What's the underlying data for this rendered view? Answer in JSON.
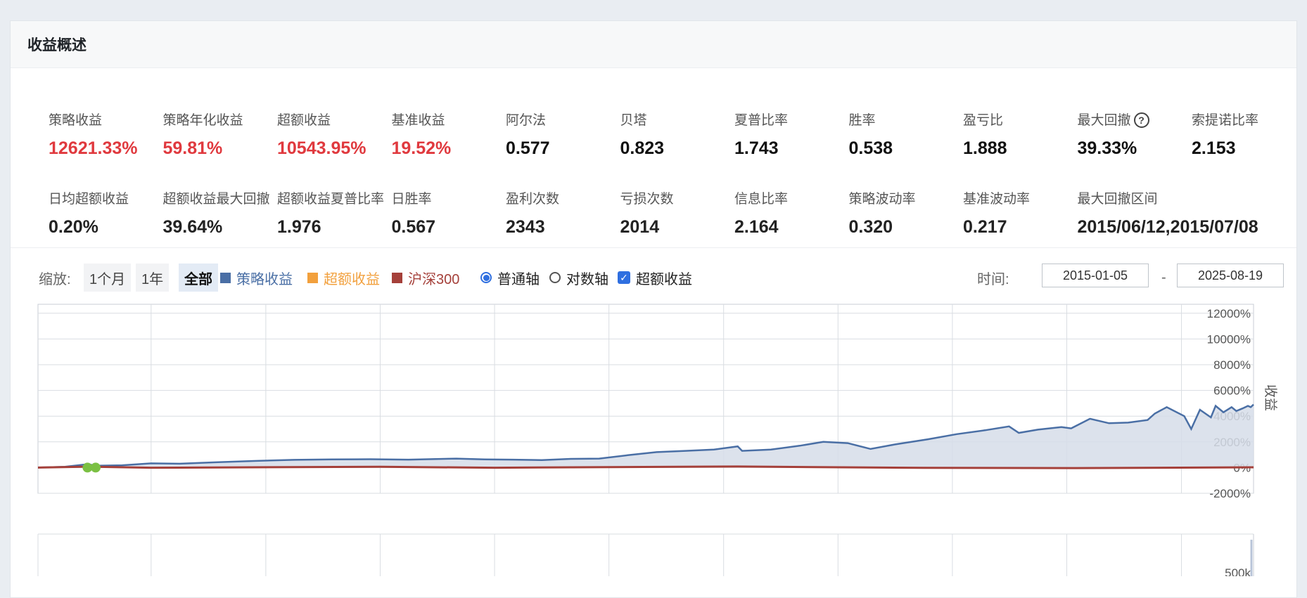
{
  "panel": {
    "title": "收益概述"
  },
  "metrics_row1": [
    {
      "label": "策略收益",
      "value": "12621.33%",
      "color": "#e0393e"
    },
    {
      "label": "策略年化收益",
      "value": "59.81%",
      "color": "#e0393e"
    },
    {
      "label": "超额收益",
      "value": "10543.95%",
      "color": "#e0393e"
    },
    {
      "label": "基准收益",
      "value": "19.52%",
      "color": "#e0393e"
    },
    {
      "label": "阿尔法",
      "value": "0.577",
      "color": "#111111"
    },
    {
      "label": "贝塔",
      "value": "0.823",
      "color": "#111111"
    },
    {
      "label": "夏普比率",
      "value": "1.743",
      "color": "#111111"
    },
    {
      "label": "胜率",
      "value": "0.538",
      "color": "#111111"
    },
    {
      "label": "盈亏比",
      "value": "1.888",
      "color": "#111111"
    },
    {
      "label": "最大回撤",
      "value": "39.33%",
      "color": "#111111",
      "help": "?"
    },
    {
      "label": "索提诺比率",
      "value": "2.153",
      "color": "#111111"
    }
  ],
  "metrics_row2": [
    {
      "label": "日均超额收益",
      "value": "0.20%"
    },
    {
      "label": "超额收益最大回撤",
      "value": "39.64%"
    },
    {
      "label": "超额收益夏普比率",
      "value": "1.976"
    },
    {
      "label": "日胜率",
      "value": "0.567"
    },
    {
      "label": "盈利次数",
      "value": "2343"
    },
    {
      "label": "亏损次数",
      "value": "2014"
    },
    {
      "label": "信息比率",
      "value": "2.164"
    },
    {
      "label": "策略波动率",
      "value": "0.320"
    },
    {
      "label": "基准波动率",
      "value": "0.217"
    },
    {
      "label": "最大回撤区间",
      "value": "2015/06/12,2015/07/08"
    }
  ],
  "toolbar": {
    "zoom_label": "缩放:",
    "zoom_1m": "1个月",
    "zoom_1y": "1年",
    "zoom_all": "全部",
    "legend_strategy": "策略收益",
    "legend_excess": "超额收益",
    "legend_benchmark": "沪深300",
    "axis_normal": "普通轴",
    "axis_log": "对数轴",
    "excess_toggle": "超额收益",
    "time_label": "时间:",
    "date_from": "2015-01-05",
    "date_sep": "-",
    "date_to": "2025-08-19"
  },
  "colors": {
    "strategy": "#4a6fa5",
    "excess": "#f2a03d",
    "benchmark": "#a5403a",
    "positive": "#e0393e",
    "drawdown_marker": "#7bc043"
  },
  "chart_data": {
    "type": "area",
    "ylabel": "收益",
    "yticks": [
      "12000%",
      "10000%",
      "8000%",
      "6000%",
      "4000%",
      "2000%",
      "0%",
      "-2000%"
    ],
    "ylim": [
      -2000,
      12700
    ],
    "xlim": [
      "2015-01-05",
      "2025-08-19"
    ],
    "xgrid_dates": [
      "2016-01-01",
      "2017-01-01",
      "2018-01-01",
      "2019-01-01",
      "2020-01-01",
      "2021-01-01",
      "2022-01-01",
      "2023-01-01",
      "2024-01-01",
      "2025-01-01"
    ],
    "drawdown_markers": [
      "2015-06-12",
      "2015-07-08"
    ],
    "series": [
      {
        "name": "策略收益",
        "values": [
          [
            "2015-01-05",
            0
          ],
          [
            "2015-04-01",
            60
          ],
          [
            "2015-06-12",
            260
          ],
          [
            "2015-07-08",
            150
          ],
          [
            "2015-10-01",
            180
          ],
          [
            "2016-01-01",
            330
          ],
          [
            "2016-04-01",
            300
          ],
          [
            "2016-08-01",
            420
          ],
          [
            "2016-12-01",
            520
          ],
          [
            "2017-04-01",
            600
          ],
          [
            "2017-08-01",
            640
          ],
          [
            "2017-12-01",
            650
          ],
          [
            "2018-04-01",
            620
          ],
          [
            "2018-09-01",
            700
          ],
          [
            "2018-12-01",
            640
          ],
          [
            "2019-03-01",
            620
          ],
          [
            "2019-06-01",
            580
          ],
          [
            "2019-09-01",
            680
          ],
          [
            "2019-12-01",
            700
          ],
          [
            "2020-03-01",
            960
          ],
          [
            "2020-06-01",
            1200
          ],
          [
            "2020-09-01",
            1300
          ],
          [
            "2020-12-01",
            1400
          ],
          [
            "2021-02-15",
            1650
          ],
          [
            "2021-03-01",
            1300
          ],
          [
            "2021-06-01",
            1400
          ],
          [
            "2021-09-01",
            1700
          ],
          [
            "2021-11-15",
            2000
          ],
          [
            "2022-02-01",
            1900
          ],
          [
            "2022-04-15",
            1450
          ],
          [
            "2022-07-01",
            1800
          ],
          [
            "2022-10-15",
            2200
          ],
          [
            "2023-01-15",
            2600
          ],
          [
            "2023-04-15",
            2900
          ],
          [
            "2023-07-01",
            3200
          ],
          [
            "2023-08-01",
            2700
          ],
          [
            "2023-10-01",
            2950
          ],
          [
            "2023-12-15",
            3150
          ],
          [
            "2024-01-15",
            3050
          ],
          [
            "2024-03-15",
            3800
          ],
          [
            "2024-05-15",
            3450
          ],
          [
            "2024-07-15",
            3500
          ],
          [
            "2024-09-15",
            3700
          ],
          [
            "2024-10-08",
            4200
          ],
          [
            "2024-11-15",
            4700
          ],
          [
            "2025-01-10",
            4000
          ],
          [
            "2025-02-01",
            3000
          ],
          [
            "2025-03-01",
            4500
          ],
          [
            "2025-04-05",
            3900
          ],
          [
            "2025-04-20",
            4800
          ],
          [
            "2025-05-15",
            4300
          ],
          [
            "2025-06-10",
            4700
          ],
          [
            "2025-06-25",
            4400
          ],
          [
            "2025-07-15",
            4600
          ],
          [
            "2025-08-01",
            4800
          ],
          [
            "2025-08-10",
            4700
          ],
          [
            "2025-08-19",
            4900
          ]
        ]
      },
      {
        "name": "沪深300",
        "values": [
          [
            "2015-01-05",
            0
          ],
          [
            "2015-06-12",
            70
          ],
          [
            "2016-01-01",
            -10
          ],
          [
            "2018-01-01",
            60
          ],
          [
            "2019-01-01",
            -10
          ],
          [
            "2021-02-15",
            80
          ],
          [
            "2022-10-01",
            -20
          ],
          [
            "2024-02-01",
            -40
          ],
          [
            "2025-08-19",
            20
          ]
        ]
      }
    ]
  },
  "chart2": {
    "ytick_top": "500k"
  }
}
